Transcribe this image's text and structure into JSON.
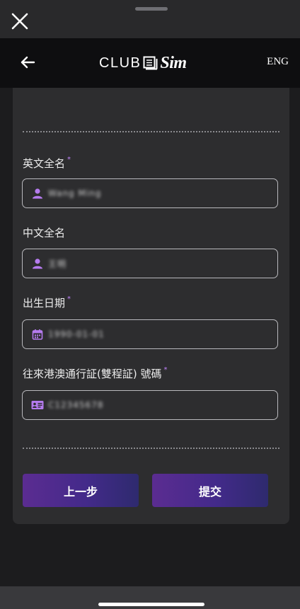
{
  "sheet": {
    "close_icon": "close-icon"
  },
  "header": {
    "back_icon": "arrow-left-icon",
    "logo_text": "CLUB",
    "logo_suffix": "Sim",
    "language": "ENG"
  },
  "form": {
    "fields": [
      {
        "label": "英文全名",
        "required_mark": "*",
        "icon": "person-icon",
        "value": "Wang Ming"
      },
      {
        "label": "中文全名",
        "required_mark": "",
        "icon": "person-icon",
        "value": "王明"
      },
      {
        "label": "出生日期",
        "required_mark": "*",
        "icon": "calendar-icon",
        "value": "1990-01-01"
      },
      {
        "label": "往來港澳通行証(雙程証) 號碼",
        "required_mark": "*",
        "icon": "id-card-icon",
        "value": "C12345678"
      }
    ],
    "prev_button": "上一步",
    "submit_button": "提交"
  },
  "colors": {
    "accent": "#c084fc",
    "button_start": "#5b2c91",
    "button_end": "#2e2a6e"
  }
}
